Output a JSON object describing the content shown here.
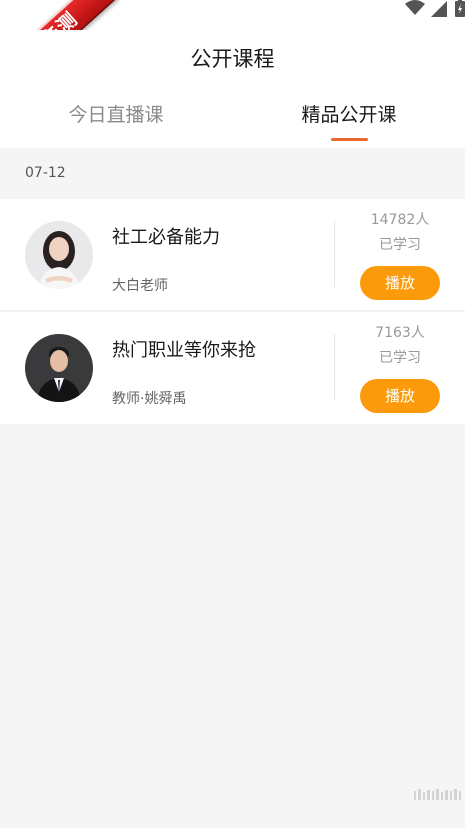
{
  "ribbon": {
    "text": "乐乐亲测"
  },
  "header": {
    "title": "公开课程"
  },
  "tabs": [
    {
      "label": "今日直播课",
      "active": false
    },
    {
      "label": "精品公开课",
      "active": true
    }
  ],
  "date_group": "07-12",
  "courses": [
    {
      "title": "社工必备能力",
      "teacher": "大白老师",
      "count": "14782人",
      "count_label": "已学习",
      "play_label": "播放"
    },
    {
      "title": "热门职业等你来抢",
      "teacher": "教师·姚舜禹",
      "count": "7163人",
      "count_label": "已学习",
      "play_label": "播放"
    }
  ],
  "colors": {
    "accent": "#e8672e",
    "play_button": "#fb9b0c",
    "ribbon": "#d41d1d",
    "background": "#f5f5f5"
  },
  "icons": {
    "status": [
      "wifi-icon",
      "signal-icon",
      "battery-icon"
    ]
  }
}
